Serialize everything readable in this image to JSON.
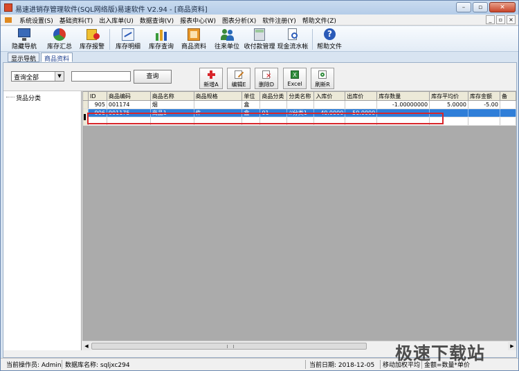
{
  "window": {
    "title": "易速进销存管理软件(SQL网络版)易速软件 V2.94 - [商品资料]",
    "buttons": {
      "minimize": "–",
      "restore": "▫",
      "close": "✕"
    }
  },
  "menubar": {
    "items": [
      "系统设置(S)",
      "基础资料(T)",
      "出入库单(U)",
      "数据查询(V)",
      "报表中心(W)",
      "图表分析(X)",
      "软件注册(Y)",
      "帮助文件(Z)"
    ],
    "mdi": {
      "minimize": "_",
      "restore": "▫",
      "close": "×"
    }
  },
  "toolbar": {
    "items": [
      "隐藏导航",
      "库存汇总",
      "库存报警",
      "库存明细",
      "库存查询",
      "商品资料",
      "往来单位",
      "收付款管理",
      "现金流水帐",
      "帮助文件"
    ]
  },
  "tabs": {
    "nav": "显示导航",
    "product": "商品资料"
  },
  "filter": {
    "select_value": "查询全部",
    "search_value": "",
    "query_button": "查询"
  },
  "actions": {
    "add": "新增A",
    "edit": "编辑E",
    "delete": "删除D",
    "excel": "Excel",
    "refresh": "刷新R"
  },
  "sidebar": {
    "tree_root": "货品分类"
  },
  "grid": {
    "columns": [
      "",
      "ID",
      "商品编码",
      "商品名称",
      "商品规格",
      "单位",
      "商品分类",
      "分类名称",
      "入库价",
      "出库价",
      "库存数量",
      "库存平均价",
      "库存金额",
      "备"
    ],
    "rows": [
      {
        "id": "905",
        "code": "001174",
        "name": "烟",
        "spec": "",
        "unit": "盒",
        "category": "",
        "category_name": "",
        "in_price": "",
        "out_price": "",
        "stock_qty": "-1.00000000",
        "avg_price": "5.0000",
        "amount": "-5.00"
      },
      {
        "id": "906",
        "code": "001175",
        "name": "商品1",
        "spec": "件",
        "unit": "盒",
        "category": "01",
        "category_name": "//分类1",
        "in_price": "40.0000",
        "out_price": "50.0000",
        "stock_qty": "",
        "avg_price": "",
        "amount": ""
      }
    ],
    "scroll_grip": "|||"
  },
  "statusbar": {
    "operator": "当前操作员: Admin",
    "database": "数据库名称: sqljxc294",
    "date": "当前日期: 2018-12-05",
    "method": "移动加权平均",
    "formula": "金额=数量*单价"
  },
  "watermark": "极速下载站",
  "colors": {
    "selected_row": "#2f7ed8",
    "highlight_border": "#d8252a",
    "grid_background": "#ababab"
  }
}
